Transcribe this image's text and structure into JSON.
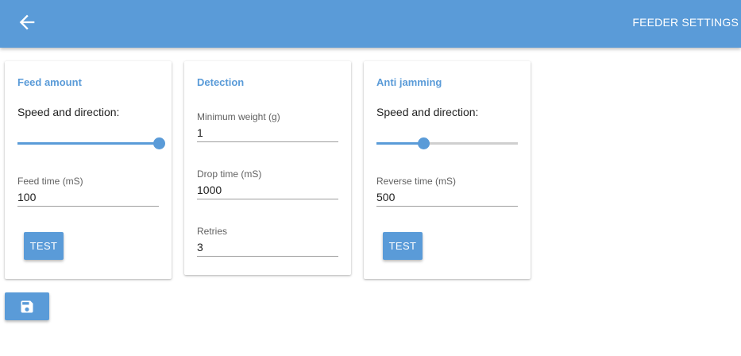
{
  "appbar": {
    "title": "FEEDER SETTINGS",
    "back_icon": "arrow-left-icon",
    "color": "#5a9bd8"
  },
  "cards": [
    {
      "title": "Feed amount",
      "slider_label": "Speed and direction:",
      "slider_value": 1.0,
      "field": {
        "label": "Feed time (mS)",
        "value": "100"
      },
      "button_label": "TEST"
    },
    {
      "title": "Detection",
      "fields": [
        {
          "label": "Minimum weight (g)",
          "value": "1"
        },
        {
          "label": "Drop time (mS)",
          "value": "1000"
        },
        {
          "label": "Retries",
          "value": "3"
        }
      ]
    },
    {
      "title": "Anti jamming",
      "slider_label": "Speed and direction:",
      "slider_value": 0.33,
      "field": {
        "label": "Reverse time (mS)",
        "value": "500"
      },
      "button_label": "TEST"
    }
  ],
  "save_button": {
    "icon": "floppy-disk-icon"
  }
}
